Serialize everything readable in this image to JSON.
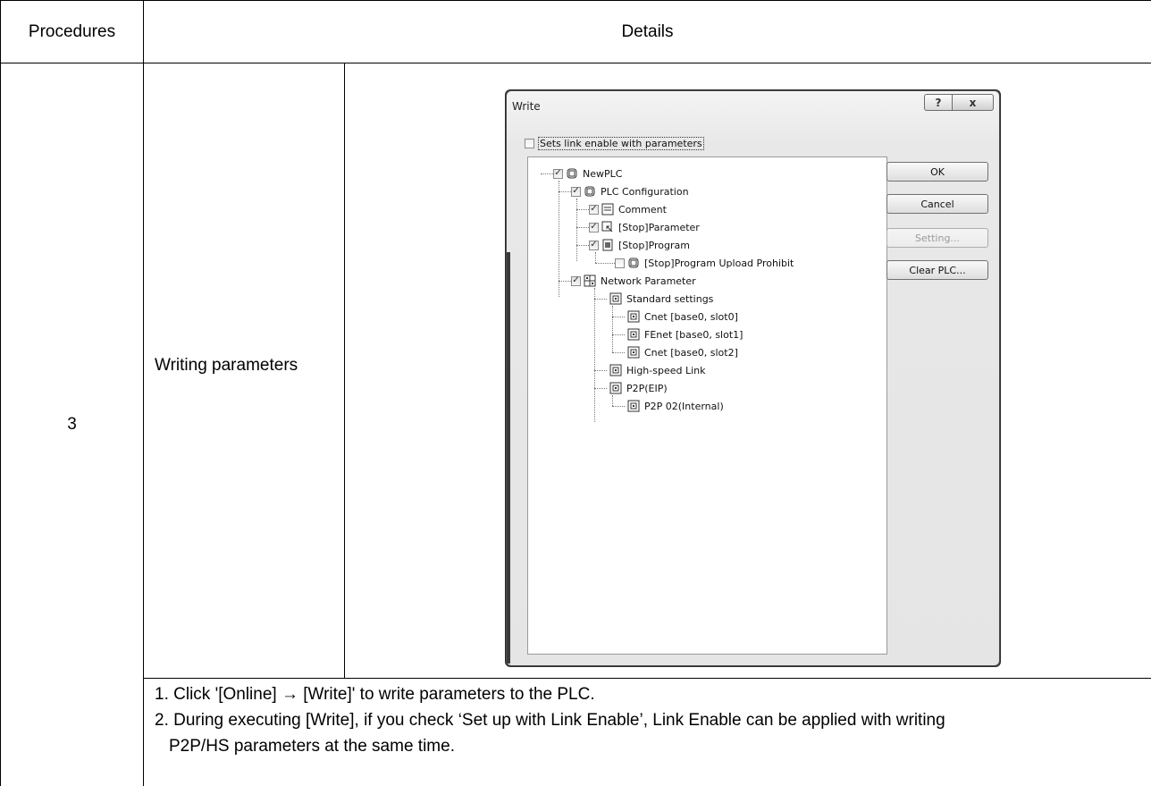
{
  "table": {
    "header_procedures": "Procedures",
    "header_details": "Details",
    "step_number": "3",
    "step_label": "Writing parameters",
    "notes": [
      "1. Click   '[Online] → [Write]' to write parameters to the PLC.",
      "2. During executing [Write], if you check ‘Set up with Link Enable’, Link Enable can be applied with writing",
      "P2P/HS parameters at the same time."
    ]
  },
  "dialog": {
    "title": "Write",
    "help_label": "?",
    "close_label": "x",
    "link_enable_label": "Sets link enable with parameters",
    "link_enable_checked": false,
    "tree": [
      {
        "label": "NewPLC",
        "checked": true,
        "icon": "plc-icon"
      },
      {
        "label": "PLC Configuration",
        "checked": true,
        "icon": "plc-icon"
      },
      {
        "label": "Comment",
        "checked": true,
        "icon": "comment-icon"
      },
      {
        "label": "[Stop]Parameter",
        "checked": true,
        "icon": "parameter-icon"
      },
      {
        "label": "[Stop]Program",
        "checked": true,
        "icon": "program-icon"
      },
      {
        "label": "[Stop]Program Upload Prohibit",
        "checked": false,
        "icon": "plc-icon"
      },
      {
        "label": "Network Parameter",
        "checked": true,
        "icon": "network-icon"
      },
      {
        "label": "Standard settings",
        "icon": "module-icon"
      },
      {
        "label": "Cnet [base0, slot0]",
        "icon": "module-icon"
      },
      {
        "label": "FEnet [base0, slot1]",
        "icon": "module-icon"
      },
      {
        "label": "Cnet [base0, slot2]",
        "icon": "module-icon"
      },
      {
        "label": "High-speed Link",
        "icon": "module-icon"
      },
      {
        "label": "P2P(EIP)",
        "icon": "module-icon"
      },
      {
        "label": "P2P 02(Internal)",
        "icon": "module-icon"
      }
    ],
    "buttons": {
      "ok": "OK",
      "cancel": "Cancel",
      "setting": "Setting...",
      "clear_plc": "Clear PLC..."
    }
  }
}
